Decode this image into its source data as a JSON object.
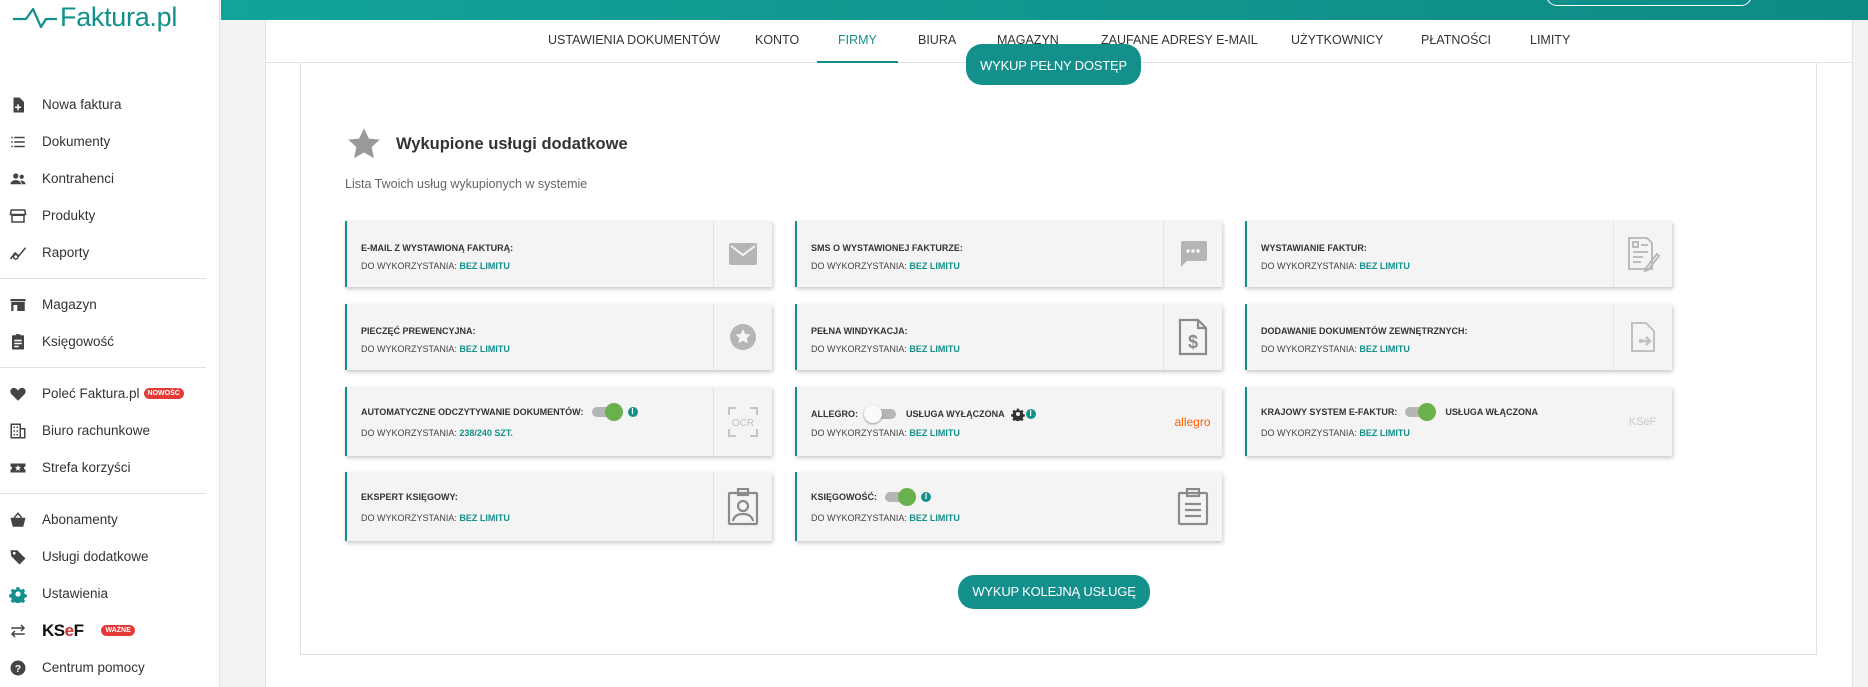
{
  "brand": {
    "name": "Faktura.pl"
  },
  "sidebar": {
    "items": [
      {
        "label": "Nowa faktura",
        "icon": "file-plus-icon"
      },
      {
        "label": "Dokumenty",
        "icon": "list-icon"
      },
      {
        "label": "Kontrahenci",
        "icon": "people-icon"
      },
      {
        "label": "Produkty",
        "icon": "store-icon"
      },
      {
        "label": "Raporty",
        "icon": "chart-icon"
      },
      {
        "label": "Magazyn",
        "icon": "warehouse-icon"
      },
      {
        "label": "Księgowość",
        "icon": "clipboard-icon"
      },
      {
        "label": "Poleć Faktura.pl",
        "icon": "heart-icon",
        "badge": "NOWOŚĆ"
      },
      {
        "label": "Biuro rachunkowe",
        "icon": "building-icon"
      },
      {
        "label": "Strefa korzyści",
        "icon": "ticket-icon"
      },
      {
        "label": "Abonamenty",
        "icon": "basket-icon"
      },
      {
        "label": "Usługi dodatkowe",
        "icon": "tag-icon"
      },
      {
        "label": "Ustawienia",
        "icon": "gear-icon"
      },
      {
        "label": "KSeF",
        "icon": "swap-icon",
        "badge": "WAŻNE"
      },
      {
        "label": "Centrum pomocy",
        "icon": "help-icon"
      }
    ]
  },
  "tabs": [
    {
      "label": "USTAWIENIA DOKUMENTÓW"
    },
    {
      "label": "KONTO"
    },
    {
      "label": "FIRMY",
      "active": true
    },
    {
      "label": "BIURA"
    },
    {
      "label": "MAGAZYN"
    },
    {
      "label": "ZAUFANE ADRESY E-MAIL"
    },
    {
      "label": "UŻYTKOWNICY"
    },
    {
      "label": "PŁATNOŚCI"
    },
    {
      "label": "LIMITY"
    }
  ],
  "main": {
    "buy_full_access": "WYKUP PEŁNY DOSTĘP",
    "section_title": "Wykupione usługi dodatkowe",
    "section_subtitle": "Lista Twoich usług wykupionych w systemie",
    "buy_next": "WYKUP KOLEJNĄ USŁUGĘ",
    "use_label": "DO WYKORZYSTANIA:",
    "services": [
      {
        "title": "E-MAIL Z WYSTAWIONĄ FAKTURĄ:",
        "value": "BEZ LIMITU",
        "icon": "mail-icon"
      },
      {
        "title": "SMS O WYSTAWIONEJ FAKTURZE:",
        "value": "BEZ LIMITU",
        "icon": "sms-icon"
      },
      {
        "title": "WYSTAWIANIE FAKTUR:",
        "value": "BEZ LIMITU",
        "icon": "invoice-edit-icon"
      },
      {
        "title": "PIECZĘĆ PREWENCYJNA:",
        "value": "BEZ LIMITU",
        "icon": "seal-icon"
      },
      {
        "title": "PEŁNA WINDYKACJA:",
        "value": "BEZ LIMITU",
        "icon": "dollar-document-icon"
      },
      {
        "title": "DODAWANIE DOKUMENTÓW ZEWNĘTRZNYCH:",
        "value": "BEZ LIMITU",
        "icon": "document-import-icon"
      },
      {
        "title": "AUTOMATYCZNE ODCZYTYWANIE DOKUMENTÓW:",
        "value": "238/240 SZT.",
        "icon": "ocr-icon",
        "toggle": "on"
      },
      {
        "title": "ALLEGRO:",
        "value": "BEZ LIMITU",
        "icon": "allegro-logo",
        "icon_text": "allegro",
        "toggle": "off",
        "state": "USŁUGA WYŁĄCZONA"
      },
      {
        "title": "KRAJOWY SYSTEM E-FAKTUR:",
        "value": "BEZ LIMITU",
        "icon": "ksef-icon",
        "icon_text": "KSeF",
        "toggle": "on",
        "state": "USŁUGA WŁĄCZONA"
      },
      {
        "title": "EKSPERT KSIĘGOWY:",
        "value": "BEZ LIMITU",
        "icon": "badge-person-icon"
      },
      {
        "title": "KSIĘGOWOŚĆ:",
        "value": "BEZ LIMITU",
        "icon": "clipboard-list-icon",
        "toggle": "on"
      }
    ]
  },
  "colors": {
    "accent": "#14908c",
    "toggle_on": "#6ab04c",
    "badge": "#e53935",
    "allegro": "#ff5a00"
  }
}
